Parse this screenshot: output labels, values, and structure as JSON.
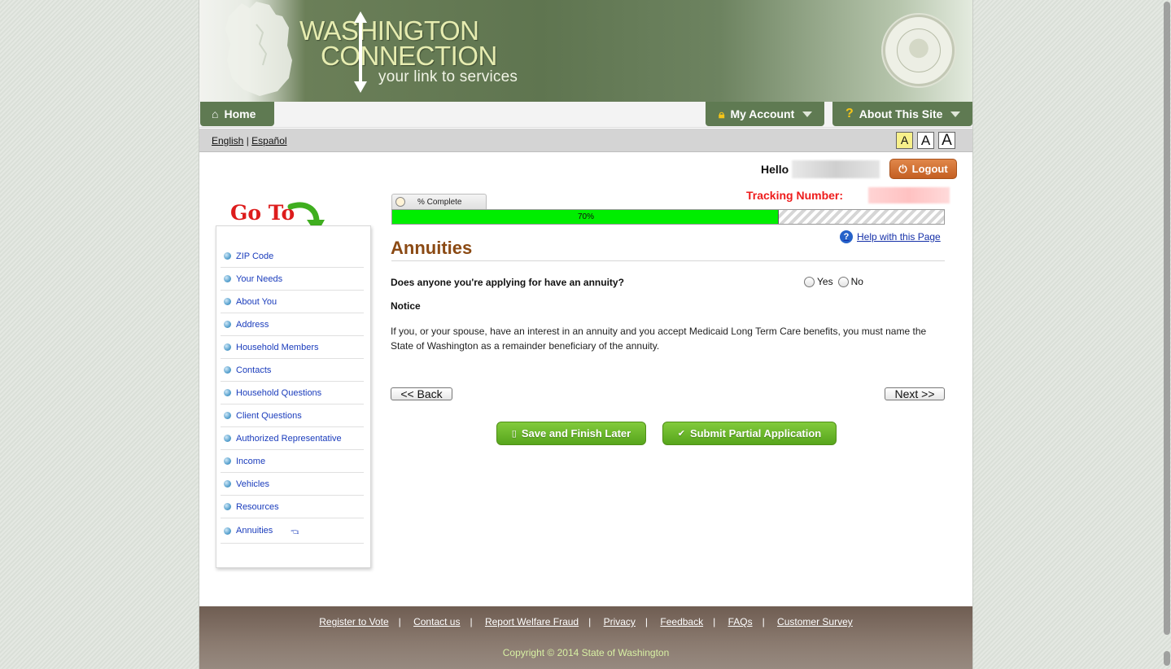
{
  "header": {
    "logo_line1": "WASHINGTON",
    "logo_line2": "CONNECTION",
    "tagline": "your link to services"
  },
  "nav": {
    "home": "Home",
    "my_account": "My Account",
    "about": "About This Site"
  },
  "language": {
    "english": "English",
    "separator": "|",
    "spanish": "Español"
  },
  "font_sizes": [
    "A",
    "A",
    "A"
  ],
  "user": {
    "hello": "Hello",
    "logout": "Logout",
    "tracking_label": "Tracking Number:"
  },
  "sidebar": {
    "goto": "Go To",
    "items": [
      {
        "label": "ZIP Code"
      },
      {
        "label": "Your Needs"
      },
      {
        "label": "About You"
      },
      {
        "label": "Address"
      },
      {
        "label": "Household Members"
      },
      {
        "label": "Contacts"
      },
      {
        "label": "Household Questions"
      },
      {
        "label": "Client Questions"
      },
      {
        "label": "Authorized Representative"
      },
      {
        "label": "Income"
      },
      {
        "label": "Vehicles"
      },
      {
        "label": "Resources"
      },
      {
        "label": "Annuities"
      }
    ],
    "current_item": "Annuities"
  },
  "progress": {
    "tab_label": "% Complete",
    "value_text": "70%",
    "fraction": 0.7
  },
  "help": {
    "label": "Help with this Page"
  },
  "main": {
    "title": "Annuities",
    "question": "Does anyone you're applying for have an annuity?",
    "options": [
      "Yes",
      "No"
    ],
    "notice_heading": "Notice",
    "notice_text": "If you, or your spouse, have an interest in an annuity and you accept Medicaid Long Term Care benefits, you must name the State of Washington as a remainder beneficiary of the annuity."
  },
  "buttons": {
    "back": "<< Back",
    "next": "Next >>",
    "save_later": "Save and Finish Later",
    "submit_partial": "Submit Partial Application"
  },
  "footer": {
    "links": [
      "Register to Vote",
      "Contact us",
      "Report Welfare Fraud",
      "Privacy",
      "Feedback",
      "FAQs",
      "Customer Survey"
    ],
    "copyright": "Copyright © 2014 State of Washington"
  },
  "colors": {
    "header_green": "#5f7a52",
    "title_brown": "#8b4a14",
    "tracking_red": "#ee1c1c",
    "progress_green": "#00ee00",
    "logout_orange": "#d4703a",
    "button_green": "#6cb82a",
    "footer_brown": "#7c6a5f"
  }
}
